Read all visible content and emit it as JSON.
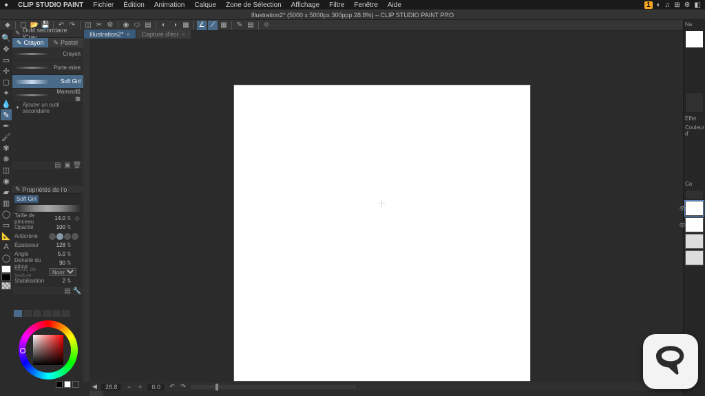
{
  "menu": {
    "app": "CLIP STUDIO PAINT",
    "items": [
      "Fichier",
      "Édition",
      "Animation",
      "Calque",
      "Zone de Sélection",
      "Affichage",
      "Filtre",
      "Fenêtre",
      "Aide"
    ],
    "badge": "1"
  },
  "docbar": "Illustration2* (5000 x 5000px 300ppp 28.8%) – CLIP STUDIO PAINT PRO",
  "filetabs": [
    {
      "label": "Illustration2*",
      "active": true
    },
    {
      "label": "Capture d'écr",
      "active": false
    }
  ],
  "subtool": {
    "title": "Outil secondaire [Cray",
    "tabs": [
      {
        "label": "Crayon",
        "active": true
      },
      {
        "label": "Pastel",
        "active": false
      }
    ],
    "brushes": [
      {
        "name": "Crayon",
        "sel": false
      },
      {
        "name": "Porte-mine",
        "sel": false
      },
      {
        "name": "Soft Girl",
        "sel": true
      },
      {
        "name": "Mameo鉛筆",
        "sel": false
      }
    ],
    "add": "Ajouter un outil secondaire"
  },
  "props": {
    "title": "Propriétés de l'o",
    "current": "Soft Girl",
    "rows": {
      "size": {
        "label": "Taille de pinceau",
        "value": "14.0"
      },
      "opacity": {
        "label": "Opacité",
        "value": "100"
      },
      "anti": {
        "label": "Anticréne"
      },
      "thickness": {
        "label": "Épaisseur",
        "value": "128"
      },
      "angle": {
        "label": "Angle",
        "value": "5.0"
      },
      "density": {
        "label": "Densité du pince",
        "value": "90"
      },
      "texmode": {
        "label": "Mode de texture",
        "value": "Normal"
      },
      "stab": {
        "label": "Stabilisation",
        "value": "2"
      }
    }
  },
  "right": {
    "nav": "Na",
    "effet": "Effet",
    "couleur": "Couleur d'",
    "calque": "Ca"
  },
  "status": {
    "zoom": "28.8",
    "rotate": "0.0"
  }
}
